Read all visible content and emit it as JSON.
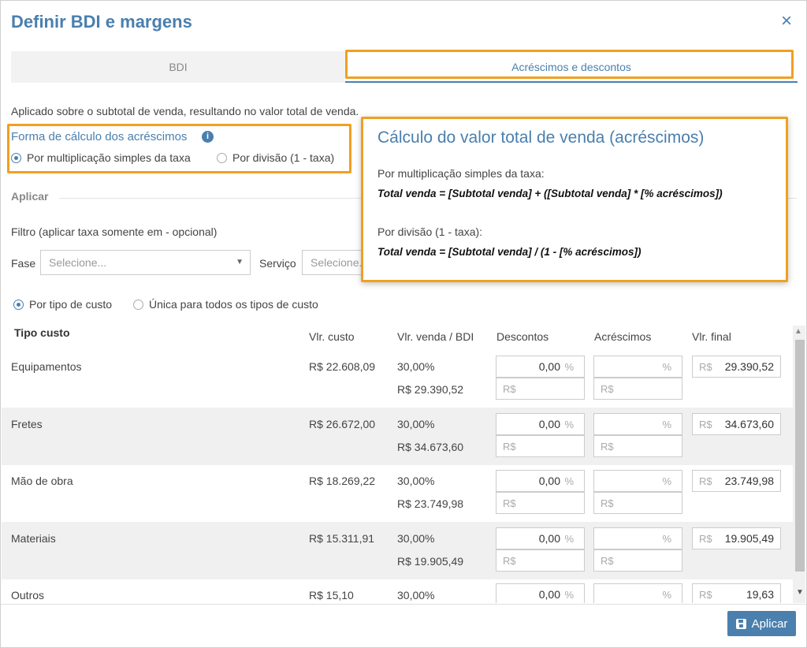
{
  "dialog": {
    "title": "Definir BDI e margens",
    "close": "×"
  },
  "tabs": [
    {
      "label": "BDI"
    },
    {
      "label": "Acréscimos e descontos"
    }
  ],
  "subtitle": "Aplicado sobre o subtotal de venda, resultando no valor total de venda.",
  "forma": {
    "label": "Forma de cálculo dos acréscimos",
    "info": "i",
    "options": [
      "Por multiplicação simples da taxa",
      "Por divisão (1 - taxa)"
    ],
    "selected": 0
  },
  "aplicar_section": "Aplicar",
  "filtro": {
    "label": "Filtro (aplicar taxa somente em - opcional)",
    "fase_label": "Fase",
    "fase_placeholder": "Selecione...",
    "servico_label": "Serviço",
    "servico_placeholder": "Selecione..."
  },
  "popover": {
    "title": "Cálculo do valor total de venda (acréscimos)",
    "mult_label": "Por multiplicação simples da taxa:",
    "mult_formula": "Total venda = [Subtotal venda] + ([Subtotal venda] * [% acréscimos])",
    "div_label": "Por divisão (1 - taxa):",
    "div_formula": "Total venda = [Subtotal venda] / (1 - [% acréscimos])"
  },
  "tipo_options": [
    "Por tipo de custo",
    "Única para todos os tipos de custo"
  ],
  "table": {
    "headers": {
      "tipo": "Tipo custo",
      "custo": "Vlr. custo",
      "venda": "Vlr. venda / BDI",
      "descontos": "Descontos",
      "acrescimos": "Acréscimos",
      "final": "Vlr. final"
    },
    "units": {
      "percent": "%",
      "currency": "R$"
    },
    "rows": [
      {
        "tipo": "Equipamentos",
        "custo": "R$ 22.608,09",
        "bdi": "30,00%",
        "venda": "R$ 29.390,52",
        "desconto": "0,00",
        "final": "29.390,52"
      },
      {
        "tipo": "Fretes",
        "custo": "R$ 26.672,00",
        "bdi": "30,00%",
        "venda": "R$ 34.673,60",
        "desconto": "0,00",
        "final": "34.673,60"
      },
      {
        "tipo": "Mão de obra",
        "custo": "R$ 18.269,22",
        "bdi": "30,00%",
        "venda": "R$ 23.749,98",
        "desconto": "0,00",
        "final": "23.749,98"
      },
      {
        "tipo": "Materiais",
        "custo": "R$ 15.311,91",
        "bdi": "30,00%",
        "venda": "R$ 19.905,49",
        "desconto": "0,00",
        "final": "19.905,49"
      },
      {
        "tipo": "Outros",
        "custo": "R$ 15,10",
        "bdi": "30,00%",
        "venda": "",
        "desconto": "0,00",
        "final": "19,63"
      }
    ]
  },
  "apply_button": "Aplicar",
  "colors": {
    "accent": "#4a7fae",
    "highlight": "#f0a020"
  }
}
